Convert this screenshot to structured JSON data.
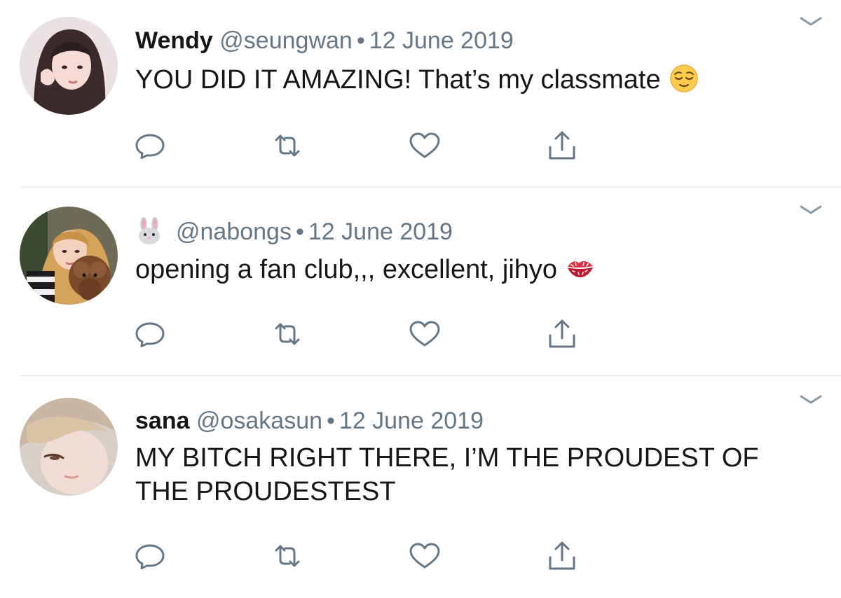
{
  "tweets": [
    {
      "display_name": "Wendy",
      "handle": "@seungwan",
      "separator": "•",
      "date": "12 June 2019",
      "text": "YOU DID IT AMAZING! That’s my classmate",
      "emoji": "relieved-face"
    },
    {
      "display_name": "",
      "name_emoji": "rabbit-face",
      "handle": "@nabongs",
      "separator": "•",
      "date": "12 June 2019",
      "text": "opening a fan club,,, excellent, jihyo",
      "emoji": "kiss-mark"
    },
    {
      "display_name": "sana",
      "handle": "@osakasun",
      "separator": "•",
      "date": "12 June 2019",
      "text": "MY BITCH RIGHT THERE, I’M THE PROUDEST OF THE PROUDESTEST",
      "emoji": ""
    }
  ],
  "icons": {
    "reply": "reply-icon",
    "retweet": "retweet-icon",
    "like": "heart-icon",
    "share": "share-icon",
    "more": "chevron-down-icon"
  },
  "colors": {
    "icon": "#657786",
    "text": "#14171a",
    "secondary": "#657786",
    "divider": "#dfe3e6"
  }
}
